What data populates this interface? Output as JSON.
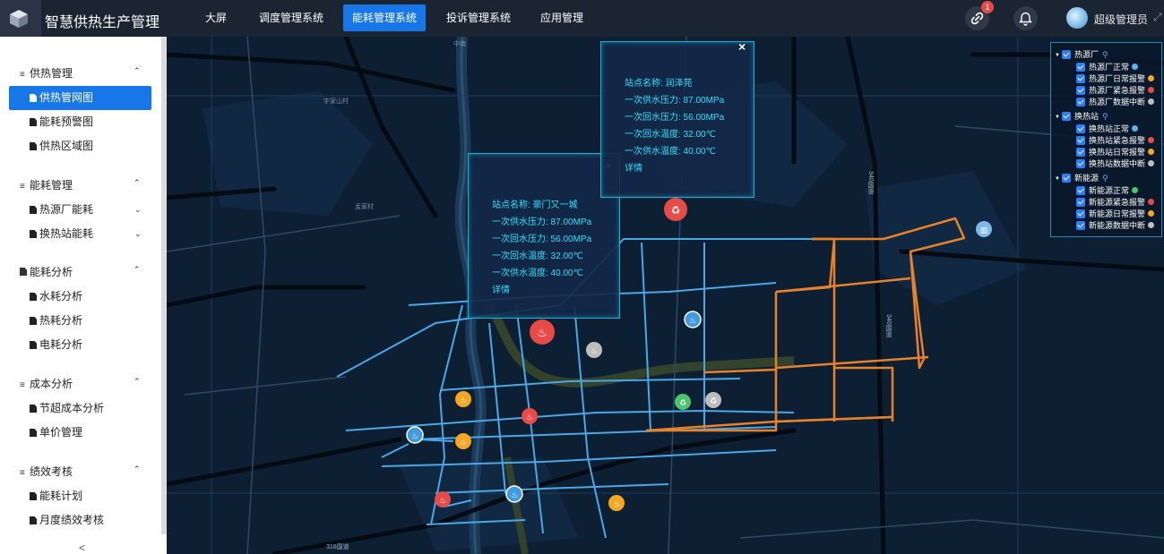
{
  "header": {
    "app_title": "智慧供热生产管理",
    "nav": [
      "大屏",
      "调度管理系统",
      "能耗管理系统",
      "投诉管理系统",
      "应用管理"
    ],
    "active_nav": "能耗管理系统",
    "notification_count": "1",
    "user_name": "超级管理员"
  },
  "sidebar": {
    "groups": [
      {
        "label": "供热管理",
        "items": [
          "供热管网图",
          "能耗预警图",
          "供热区域图"
        ]
      },
      {
        "label": "能耗管理",
        "items": [
          "热源厂能耗",
          "换热站能耗"
        ]
      },
      {
        "label": "能耗分析",
        "items": [
          "水耗分析",
          "热耗分析",
          "电耗分析"
        ]
      },
      {
        "label": "成本分析",
        "items": [
          "节超成本分析",
          "单价管理"
        ]
      },
      {
        "label": "绩效考核",
        "items": [
          "能耗计划",
          "月度绩效考核"
        ]
      }
    ],
    "active_item": "供热管网图",
    "collapse_glyph": "<"
  },
  "map": {
    "place_labels": [
      "中南",
      "宇家山村",
      "孟家村",
      "340国道",
      "340国道",
      "316国道"
    ],
    "popup_a": {
      "station": "站点名称: 豪门又一城",
      "supply_pressure": "一次供水压力: 87.00MPa",
      "return_pressure": "一次回水压力: 56.00MPa",
      "return_temp": "一次回水温度: 32.00℃",
      "supply_temp": "一次供水温度: 40.00℃",
      "detail": "详情"
    },
    "popup_b": {
      "station": "站点名称: 润泽苑",
      "supply_pressure": "一次供水压力: 87.00MPa",
      "return_pressure": "一次回水压力: 56.00MPa",
      "return_temp": "一次回水温度: 32.00℃",
      "supply_temp": "一次供水温度: 40.00℃",
      "detail": "详情"
    }
  },
  "legend": {
    "groups": [
      {
        "label": "热源厂",
        "items": [
          {
            "label": "热源厂正常",
            "color": "#5ab4f0"
          },
          {
            "label": "热源厂日常报警",
            "color": "#f5a623"
          },
          {
            "label": "热源厂紧急报警",
            "color": "#e84a47"
          },
          {
            "label": "热源厂数据中断",
            "color": "#bdbdbd"
          }
        ]
      },
      {
        "label": "换热站",
        "items": [
          {
            "label": "换热站正常",
            "color": "#5ab4f0"
          },
          {
            "label": "换热站紧急报警",
            "color": "#e84a47"
          },
          {
            "label": "换热站日常报警",
            "color": "#f5a623"
          },
          {
            "label": "换热站数据中断",
            "color": "#bdbdbd"
          }
        ]
      },
      {
        "label": "新能源",
        "items": [
          {
            "label": "新能源正常",
            "color": "#4cc46a"
          },
          {
            "label": "新能源紧急报警",
            "color": "#e84a47"
          },
          {
            "label": "新能源日常报警",
            "color": "#f5a623"
          },
          {
            "label": "新能源数据中断",
            "color": "#bdbdbd"
          }
        ]
      }
    ]
  },
  "colors": {
    "accent": "#1877e8",
    "pipe_blue": "#4aa8e8",
    "pipe_orange": "#e8822a",
    "popup_text": "#2ee0ff"
  }
}
